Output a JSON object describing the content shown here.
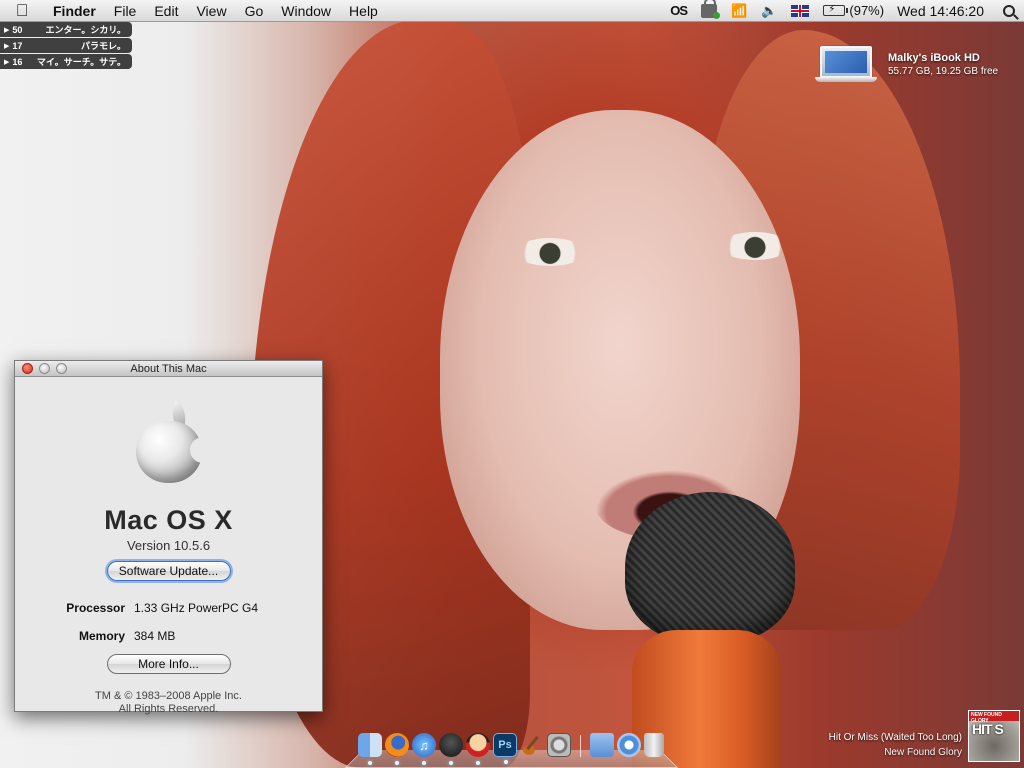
{
  "menubar": {
    "app_name": "Finder",
    "menus": [
      "File",
      "Edit",
      "View",
      "Go",
      "Window",
      "Help"
    ],
    "extras": {
      "os_label": "OS",
      "battery_percent": "(97%)",
      "clock": "Wed 14:46:20"
    },
    "icons": [
      "apple-icon",
      "lock-status-icon",
      "wifi-icon",
      "volume-icon",
      "uk-flag-icon",
      "battery-icon",
      "spotlight-icon"
    ]
  },
  "widgets": [
    {
      "number": "50",
      "text": "エンター。シカリ。"
    },
    {
      "number": "17",
      "text": "パラモレ。"
    },
    {
      "number": "16",
      "text": "マイ。サーチ。サテ。"
    }
  ],
  "drive": {
    "name": "Malky's iBook HD",
    "info": "55.77 GB, 19.25 GB free"
  },
  "about_window": {
    "title": "About This Mac",
    "os_name": "Mac OS X",
    "version": "Version 10.5.6",
    "software_update_label": "Software Update...",
    "specs": [
      {
        "label": "Processor",
        "value": "1.33 GHz PowerPC G4"
      },
      {
        "label": "Memory",
        "value": "384 MB"
      }
    ],
    "more_info_label": "More Info...",
    "copyright_line1": "TM & © 1983–2008 Apple Inc.",
    "copyright_line2": "All Rights Reserved."
  },
  "dock": {
    "items": [
      "finder-icon",
      "firefox-icon",
      "itunes-icon",
      "adium-icon",
      "gnome-icon",
      "photoshop-icon",
      "garageband-icon",
      "system-preferences-icon",
      "applications-folder-icon",
      "downloads-stack-icon",
      "trash-icon"
    ],
    "photoshop_label": "Ps"
  },
  "now_playing": {
    "track": "Hit Or Miss (Waited Too Long)",
    "artist": "New Found Glory",
    "cover_band": "NEW FOUND GLORY",
    "cover_title": "HIT S"
  }
}
